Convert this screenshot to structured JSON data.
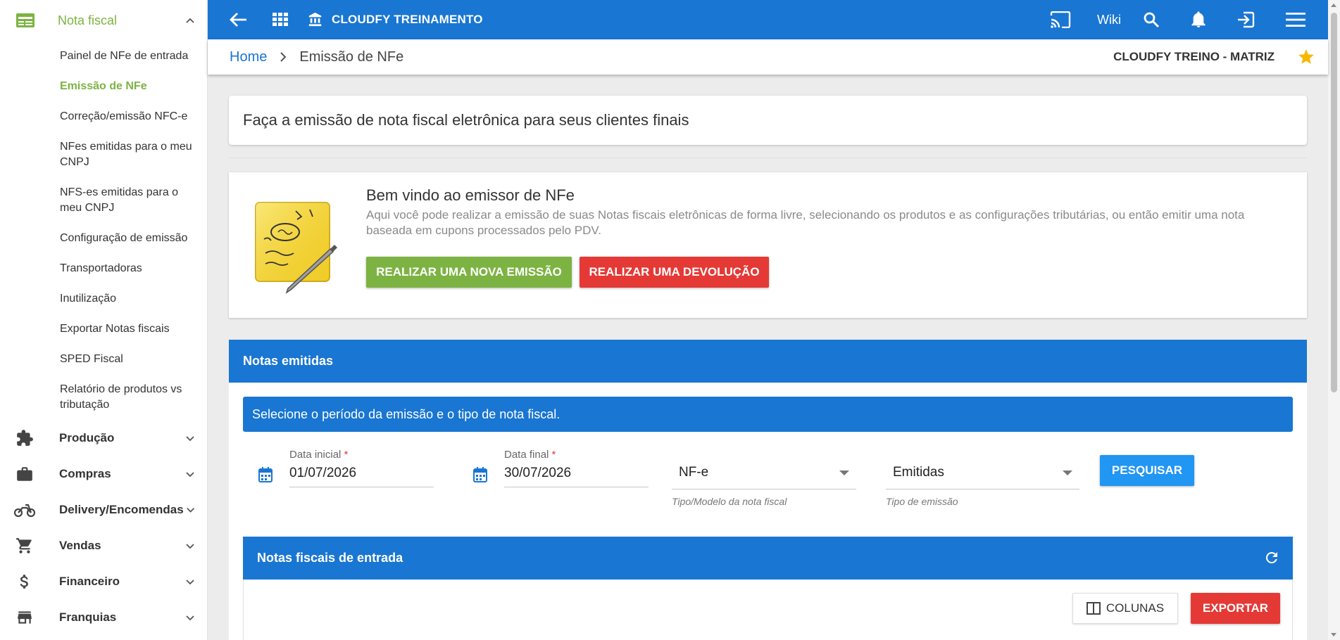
{
  "sidebar": {
    "section_title": "Nota fiscal",
    "items": [
      {
        "label": "Painel de NFe de entrada"
      },
      {
        "label": "Emissão de NFe"
      },
      {
        "label": "Correção/emissão NFC-e"
      },
      {
        "label": "NFes emitidas para o meu CNPJ"
      },
      {
        "label": "NFS-es emitidas para o meu CNPJ"
      },
      {
        "label": "Configuração de emissão"
      },
      {
        "label": "Transportadoras"
      },
      {
        "label": "Inutilização"
      },
      {
        "label": "Exportar Notas fiscais"
      },
      {
        "label": "SPED Fiscal"
      },
      {
        "label": "Relatório de produtos vs tributação"
      }
    ],
    "sections": [
      {
        "label": "Produção",
        "icon": "puzzle-icon"
      },
      {
        "label": "Compras",
        "icon": "briefcase-icon"
      },
      {
        "label": "Delivery/Encomendas",
        "icon": "motorcycle-icon"
      },
      {
        "label": "Vendas",
        "icon": "cart-icon"
      },
      {
        "label": "Financeiro",
        "icon": "dollar-icon"
      },
      {
        "label": "Franquias",
        "icon": "store-icon"
      }
    ]
  },
  "topbar": {
    "company": "CLOUDFY TREINAMENTO",
    "wiki": "Wiki"
  },
  "breadcrumb": {
    "home": "Home",
    "current": "Emissão de NFe",
    "company": "CLOUDFY TREINO - MATRIZ"
  },
  "intro": {
    "text": "Faça a emissão de nota fiscal eletrônica para seus clientes finais"
  },
  "welcome": {
    "title": "Bem vindo ao emissor de NFe",
    "description": "Aqui você pode realizar a emissão de suas Notas fiscais eletrônicas de forma livre, selecionando os produtos e as configurações tributárias, ou então emitir uma nota baseada em cupons processados pelo PDV.",
    "new_button": "REALIZAR UMA NOVA EMISSÃO",
    "return_button": "REALIZAR UMA DEVOLUÇÃO"
  },
  "notas": {
    "title": "Notas emitidas",
    "info": "Selecione o período da emissão e o tipo de nota fiscal.",
    "start_label": "Data inicial",
    "start_value": "01/07/2026",
    "end_label": "Data final",
    "end_value": "30/07/2026",
    "required_mark": "*",
    "model_value": "NF-e",
    "model_hint": "Tipo/Modelo da nota fiscal",
    "type_value": "Emitidas",
    "type_hint": "Tipo de emissão",
    "search_button": "PESQUISAR"
  },
  "entrada": {
    "title": "Notas fiscais de entrada",
    "columns_button": "COLUNAS",
    "export_button": "EXPORTAR"
  },
  "colors": {
    "primary": "#1976d2",
    "green": "#7cb342",
    "red": "#e53935",
    "search": "#2196f3"
  }
}
